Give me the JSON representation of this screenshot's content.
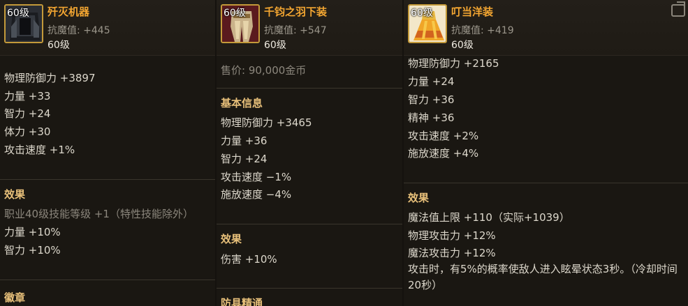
{
  "items": [
    {
      "name": "歼灭机器",
      "level_badge": "60级",
      "resist": "抗魔值: +445",
      "level": "60级",
      "stats": [
        "物理防御力 +3897",
        "力量 +33",
        "智力 +24",
        "体力 +30",
        "攻击速度 +1%"
      ],
      "effect_title": "效果",
      "effect_note": "职业40级技能等级 +1（特性技能除外）",
      "effects": [
        "力量 +10%",
        "智力 +10%"
      ],
      "footer_section": "徽章"
    },
    {
      "name": "千钧之羽下装",
      "level_badge": "60级",
      "resist": "抗魔值: +547",
      "level": "60级",
      "price": "售价: 90,000金币",
      "basic_title": "基本信息",
      "stats": [
        "物理防御力 +3465",
        "力量 +36",
        "智力 +24",
        "攻击速度 −1%",
        "施放速度 −4%"
      ],
      "effect_title": "效果",
      "effects": [
        "伤害 +10%"
      ],
      "footer_section": "防具精通"
    },
    {
      "name": "叮当洋装",
      "level_badge": "60级",
      "resist": "抗魔值: +419",
      "level": "60级",
      "stat_partial": "物理防御力 +2165",
      "stats": [
        "力量 +24",
        "智力 +36",
        "精神 +36",
        "攻击速度 +2%",
        "施放速度 +4%"
      ],
      "effect_title": "效果",
      "effects": [
        "魔法值上限 +110（实际+1039）",
        "物理攻击力 +12%",
        "魔法攻击力 +12%"
      ],
      "effect_long": "攻击时，有5%的概率使敌人进入眩晕状态3秒。（冷却时间20秒）"
    }
  ]
}
